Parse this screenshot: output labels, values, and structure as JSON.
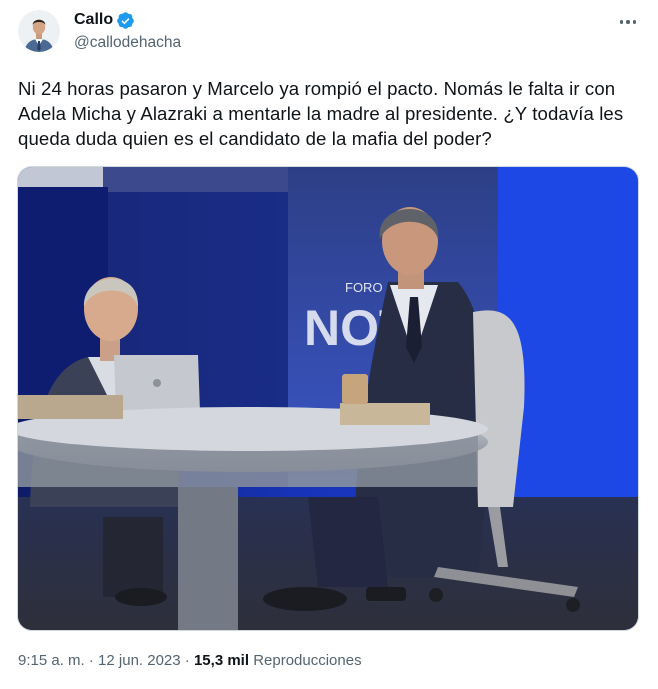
{
  "author": {
    "display_name": "Callo",
    "handle": "@callodehacha",
    "verified": true,
    "verified_color": "#1d9bf0"
  },
  "tweet": {
    "text": "Ni 24 horas pasaron y Marcelo ya rompió el pacto. Nomás le falta ir con Adela Micha y Alazraki a mentarle la madre al presidente. ¿Y todavía les queda duda quien es el candidato de la mafia del poder?"
  },
  "media": {
    "kind": "photo",
    "backdrop_text": "NOTI",
    "backdrop_small_text": "FORO"
  },
  "meta": {
    "time": "9:15 a. m.",
    "separator": "·",
    "date": "12 jun. 2023",
    "views_count": "15,3 mil",
    "views_label": "Reproducciones"
  },
  "icons": {
    "verified": "verified-badge-icon",
    "more": "more-options-icon"
  }
}
